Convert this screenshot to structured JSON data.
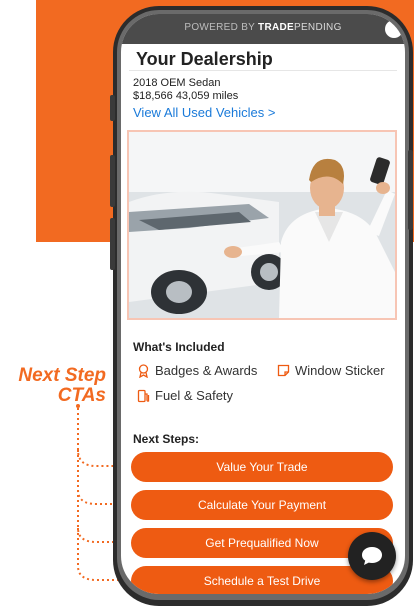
{
  "callout": {
    "line1": "Next Step",
    "line2": "CTAs"
  },
  "header": {
    "powered_prefix": "POWERED BY ",
    "brand_bold": "TRADE",
    "brand_rest": "PENDING"
  },
  "dealer": {
    "title": "Your Dealership"
  },
  "vehicle": {
    "name": "2018 OEM Sedan",
    "price_miles": "$18,566  43,059 miles",
    "view_all": "View All Used Vehicles  >"
  },
  "included": {
    "heading": "What's Included",
    "items": [
      {
        "label": "Badges & Awards",
        "icon": "badge-icon"
      },
      {
        "label": "Window Sticker",
        "icon": "sticker-icon"
      },
      {
        "label": "Fuel & Safety",
        "icon": "fuel-icon"
      }
    ]
  },
  "next_steps": {
    "heading": "Next Steps:",
    "buttons": [
      "Value Your Trade",
      "Calculate Your Payment",
      "Get Prequalified Now",
      "Schedule a Test Drive"
    ]
  },
  "colors": {
    "brand_orange": "#f26a21",
    "cta_orange": "#ee5b12",
    "link_blue": "#1a7ad9"
  }
}
